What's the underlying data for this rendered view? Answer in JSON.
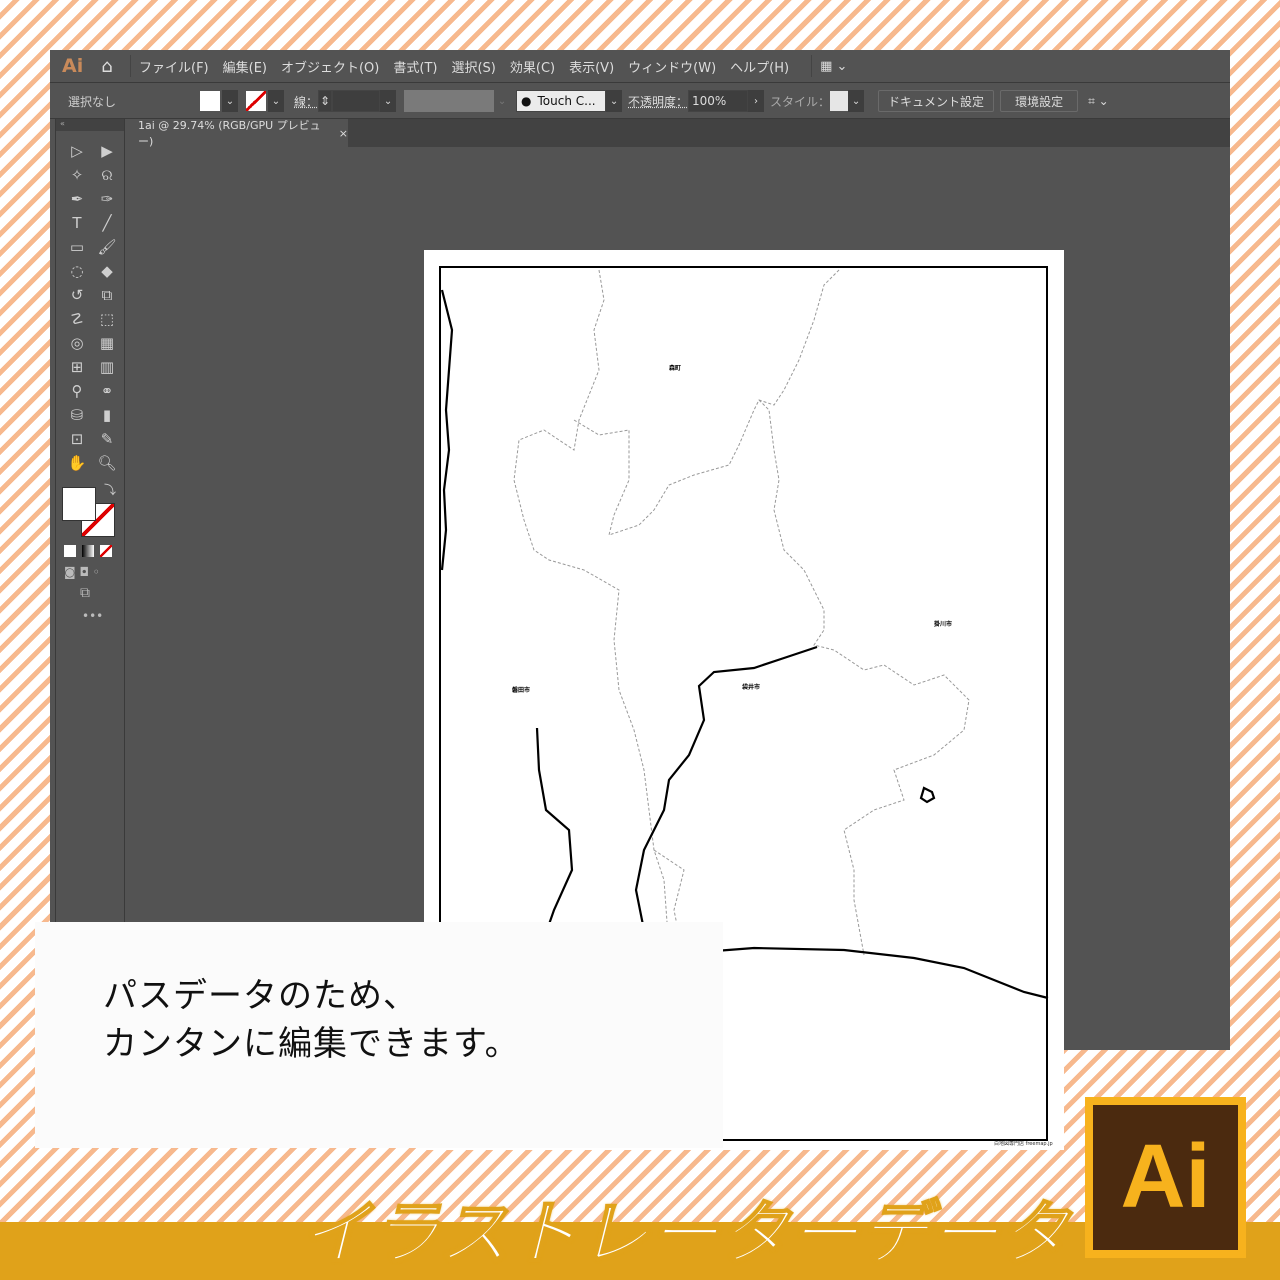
{
  "app": {
    "logo": "Ai",
    "home_icon": "home-icon"
  },
  "menu": [
    "ファイル(F)",
    "編集(E)",
    "オブジェクト(O)",
    "書式(T)",
    "選択(S)",
    "効果(C)",
    "表示(V)",
    "ウィンドウ(W)",
    "ヘルプ(H)"
  ],
  "control": {
    "selection": "選択なし",
    "stroke_label": "線：",
    "brush": "Touch C...",
    "opacity_label": "不透明度：",
    "opacity": "100%",
    "style_label": "スタイル：",
    "doc_settings": "ドキュメント設定",
    "preferences": "環境設定"
  },
  "document_tab": {
    "title": "1ai @ 29.74% (RGB/GPU プレビュー)",
    "close": "×"
  },
  "map": {
    "labels": [
      "森町",
      "掛川市",
      "磐田市",
      "袋井市"
    ],
    "credit": "白地図専門店 freemap.jp"
  },
  "promo": {
    "line1": "パスデータのため、",
    "line2": "カンタンに編集できます。",
    "banner": "イラストレーターデータ",
    "logo": "Ai"
  },
  "colors": {
    "accent": "#e0a21a",
    "ai_bg": "#4b2a0f",
    "ai_fg": "#f7b21d"
  }
}
